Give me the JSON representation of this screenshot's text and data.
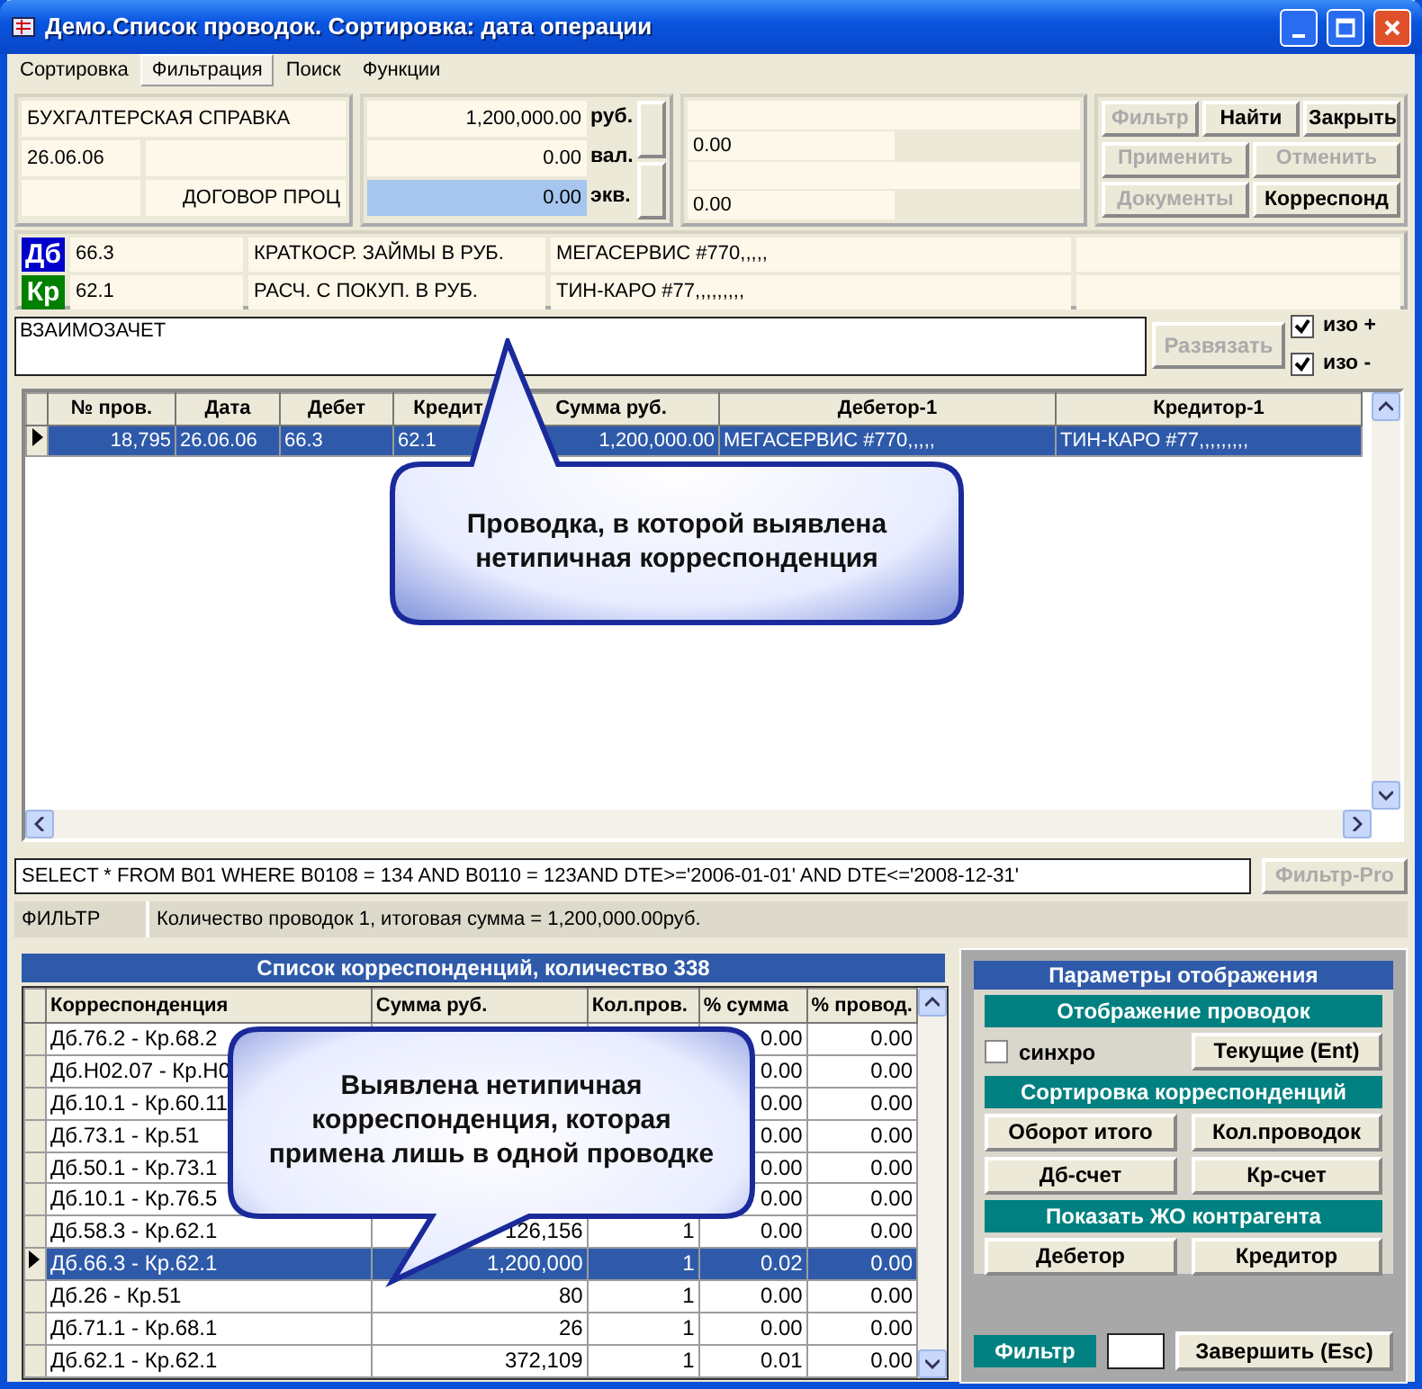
{
  "window": {
    "title": "Демо.Список проводок. Сортировка: дата операции"
  },
  "menu": [
    {
      "label": "Сортировка",
      "selected": false
    },
    {
      "label": "Фильтрация",
      "selected": true
    },
    {
      "label": "Поиск",
      "selected": false
    },
    {
      "label": "Функции",
      "selected": false
    }
  ],
  "document": {
    "type": "БУХГАЛТЕРСКАЯ СПРАВКА",
    "date": "26.06.06",
    "basis": "ДОГОВОР ПРОЦ"
  },
  "amounts": [
    {
      "value": "1,200,000.00",
      "unit": "руб.",
      "highlighted": false
    },
    {
      "value": "0.00",
      "unit": "вал.",
      "highlighted": false
    },
    {
      "value": "0.00",
      "unit": "экв.",
      "highlighted": true
    }
  ],
  "extra_values": [
    "0.00",
    "0.00"
  ],
  "buttons": [
    {
      "label": "Фильтр",
      "disabled": true
    },
    {
      "label": "Найти",
      "disabled": false
    },
    {
      "label": "Закрыть",
      "disabled": false
    },
    {
      "label": "Применить",
      "disabled": true
    },
    {
      "label": "Отменить",
      "disabled": true
    },
    {
      "label": "Документы",
      "disabled": true
    },
    {
      "label": "Корреспонд",
      "disabled": false
    }
  ],
  "accounts": [
    {
      "badge": "Дб",
      "color": "#0000cc",
      "account": "66.3",
      "name": "КРАТКОСР. ЗАЙМЫ В РУБ.",
      "party": "МЕГАСЕРВИС #770,,,,,"
    },
    {
      "badge": "Кр",
      "color": "#008000",
      "account": "62.1",
      "name": "РАСЧ. С ПОКУП. В РУБ.",
      "party": "ТИН-КАРО #77,,,,,,,,,"
    }
  ],
  "comment": "ВЗАИМОЗАЧЕТ",
  "unlink_button": {
    "label": "Развязать",
    "disabled": true
  },
  "options": [
    {
      "label": "изо +",
      "checked": true
    },
    {
      "label": "изо -",
      "checked": true
    }
  ],
  "entries_table": {
    "columns": [
      "№ пров.",
      "Дата",
      "Дебет",
      "Кредит",
      "Сумма руб.",
      "Дебетор-1",
      "Кредитор-1"
    ],
    "rows": [
      {
        "selected": true,
        "cells": [
          "18,795",
          "26.06.06",
          "66.3",
          "62.1",
          "1,200,000.00",
          "МЕГАСЕРВИС #770,,,,,",
          "ТИН-КАРО #77,,,,,,,,,"
        ]
      }
    ]
  },
  "callouts": [
    {
      "text": "Проводка, в которой выявлена нетипичная корреспонденция"
    },
    {
      "text": "Выявлена нетипичная корреспонденция, которая примена лишь в одной проводке"
    }
  ],
  "sql": "SELECT * FROM B01 WHERE B0108 = 134 AND B0110 = 123AND DTE>='2006-01-01' AND DTE<='2008-12-31'",
  "filter_pro_button": {
    "label": "Фильтр-Pro",
    "disabled": true
  },
  "status": {
    "mode": "ФИЛЬТР",
    "summary": "Количество проводок 1, итоговая сумма = 1,200,000.00руб."
  },
  "correspondence": {
    "title": "Список  корреспонденций, количество 338",
    "columns": [
      "Корреспонденция",
      "Сумма руб.",
      "Кол.пров.",
      "% сумма",
      "% провод."
    ],
    "rows": [
      {
        "selected": false,
        "correspondence": "Дб.76.2 - Кр.68.2",
        "pct_sum": "0.00",
        "pct_entries": "0.00"
      },
      {
        "selected": false,
        "correspondence": "Дб.Н02.07 - Кр.Н0",
        "pct_sum": "0.00",
        "pct_entries": "0.00"
      },
      {
        "selected": false,
        "correspondence": "Дб.10.1 - Кр.60.11",
        "pct_sum": "0.00",
        "pct_entries": "0.00"
      },
      {
        "selected": false,
        "correspondence": "Дб.73.1 - Кр.51",
        "pct_sum": "0.00",
        "pct_entries": "0.00"
      },
      {
        "selected": false,
        "correspondence": "Дб.50.1 - Кр.73.1",
        "pct_sum": "0.00",
        "pct_entries": "0.00"
      },
      {
        "selected": false,
        "correspondence": "Дб.10.1 - Кр.76.5",
        "pct_sum": "0.00",
        "pct_entries": "0.00"
      },
      {
        "selected": false,
        "correspondence": "Дб.58.3 - Кр.62.1",
        "sum": "126,156",
        "count": "1",
        "pct_sum": "0.00",
        "pct_entries": "0.00"
      },
      {
        "selected": true,
        "correspondence": "Дб.66.3 - Кр.62.1",
        "sum": "1,200,000",
        "count": "1",
        "pct_sum": "0.02",
        "pct_entries": "0.00"
      },
      {
        "selected": false,
        "correspondence": "Дб.26 - Кр.51",
        "sum": "80",
        "count": "1",
        "pct_sum": "0.00",
        "pct_entries": "0.00"
      },
      {
        "selected": false,
        "correspondence": "Дб.71.1 - Кр.68.1",
        "sum": "26",
        "count": "1",
        "pct_sum": "0.00",
        "pct_entries": "0.00"
      },
      {
        "selected": false,
        "correspondence": "Дб.62.1 - Кр.62.1",
        "sum": "372,109",
        "count": "1",
        "pct_sum": "0.01",
        "pct_entries": "0.00"
      }
    ]
  },
  "display_panel": {
    "title": "Параметры отображения",
    "sections": [
      {
        "title": "Отображение  проводок",
        "items": [
          {
            "kind": "checkbox",
            "label": "синхро",
            "checked": false
          },
          {
            "kind": "button",
            "label": "Текущие (Ent)"
          }
        ]
      },
      {
        "title": "Сортировка корреспонденций",
        "items": [
          {
            "kind": "button",
            "label": "Оборот  итого"
          },
          {
            "kind": "button",
            "label": "Кол.проводок"
          },
          {
            "kind": "button",
            "label": "Дб-счет"
          },
          {
            "kind": "button",
            "label": "Кр-счет"
          }
        ]
      },
      {
        "title": "Показать ЖО контрагента",
        "items": [
          {
            "kind": "button",
            "label": "Дебетор"
          },
          {
            "kind": "button",
            "label": "Кредитор"
          }
        ]
      }
    ]
  },
  "footer": {
    "filter_label": "Фильтр",
    "finish_button": "Завершить (Esc)"
  }
}
